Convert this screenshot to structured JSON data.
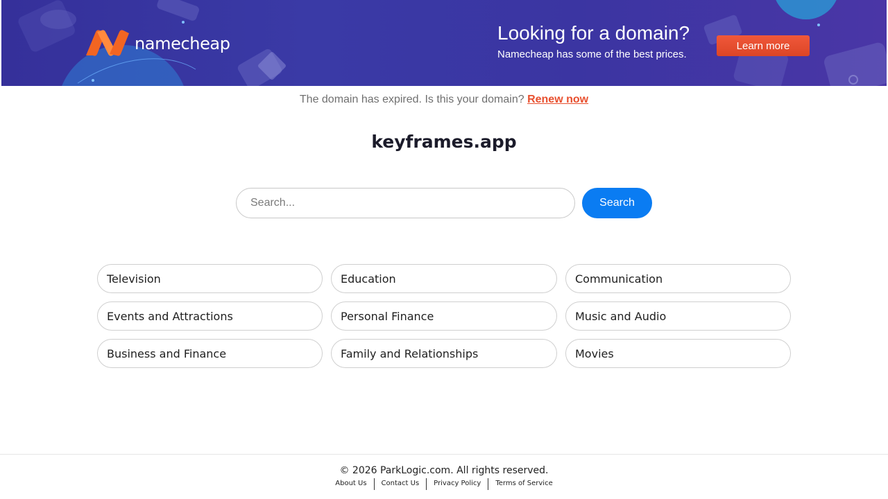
{
  "banner": {
    "logo_text": "namecheap",
    "title": "Looking for a domain?",
    "subtitle": "Namecheap has some of the best prices.",
    "cta_label": "Learn more",
    "colors": {
      "background": "#3a3aa6",
      "logo_orange": "#f26522",
      "cta": "#e84e30"
    }
  },
  "notice": {
    "text": "The domain has expired. Is this your domain?",
    "link_label": "Renew now"
  },
  "domain": {
    "name": "keyframes.app"
  },
  "search": {
    "placeholder": "Search...",
    "value": "",
    "button_label": "Search",
    "button_color": "#0a7cf2"
  },
  "categories": [
    "Television",
    "Education",
    "Communication",
    "Events and Attractions",
    "Personal Finance",
    "Music and Audio",
    "Business and Finance",
    "Family and Relationships",
    "Movies"
  ],
  "footer": {
    "copyright": "© 2026 ParkLogic.com. All rights reserved.",
    "links": [
      "About Us",
      "Contact Us",
      "Privacy Policy",
      "Terms of Service"
    ]
  }
}
